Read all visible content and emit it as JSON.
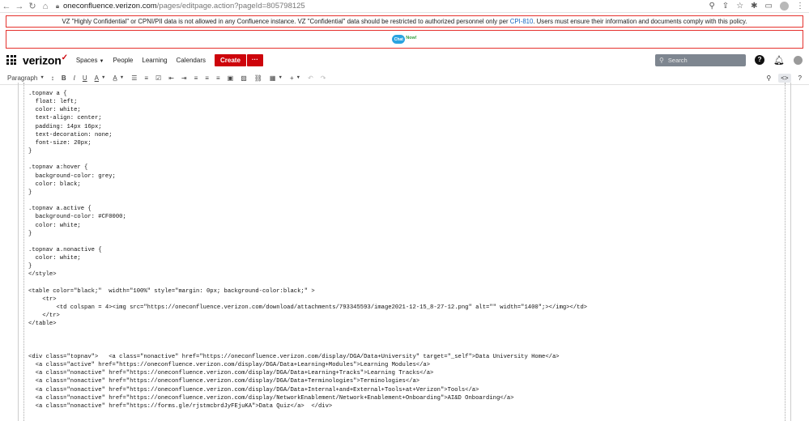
{
  "browser": {
    "url_host": "oneconfluence.verizon.com",
    "url_path": "/pages/editpage.action?pageId=805798125"
  },
  "banner": {
    "text_before": "VZ \"Highly Confidential\" or CPNI/PII data is not allowed in any Confluence instance. VZ \"Confidential\" data should be restricted to authorized personnel only per ",
    "link": "CPI-810",
    "text_after": ". Users must ensure their information and documents comply with this policy."
  },
  "chat": {
    "bubble": "Chat",
    "now": "Now!"
  },
  "header": {
    "logo": "verizon",
    "logo_mark": "✓",
    "nav": [
      "Spaces",
      "People",
      "Learning",
      "Calendars"
    ],
    "create_label": "Create",
    "more_label": "···",
    "search_placeholder": "Search",
    "help_label": "?"
  },
  "toolbar": {
    "paragraph_label": "Paragraph"
  },
  "editor": {
    "lines": [
      ".topnav a {",
      "  float: left;",
      "  color: white;",
      "  text-align: center;",
      "  padding: 14px 16px;",
      "  text-decoration: none;",
      "  font-size: 20px;",
      "}",
      "",
      ".topnav a:hover {",
      "  background-color: grey;",
      "  color: black;",
      "}",
      "",
      ".topnav a.active {",
      "  background-color: #CF0000;",
      "  color: white;",
      "}",
      "",
      ".topnav a.nonactive {",
      "  color: white;",
      "}",
      "</style>",
      "",
      "<table color=\"black;\"  width=\"100%\" style=\"margin: 0px; background-color:black;\" >",
      "    <tr>",
      "        <td colspan = 4><img src=\"https://oneconfluence.verizon.com/download/attachments/793345593/image2021-12-15_8-27-12.png\" alt=\"\" width=\"1400\";></img></td>",
      "    </tr>",
      "</table>",
      "",
      "",
      "",
      "<div class=\"topnav\">   <a class=\"nonactive\" href=\"https://oneconfluence.verizon.com/display/DGA/Data+University\" target=\"_self\">Data University Home</a>",
      "  <a class=\"active\" href=\"https://oneconfluence.verizon.com/display/DGA/Data+Learning+Modules\">Learning Modules</a>",
      "  <a class=\"nonactive\" href=\"https://oneconfluence.verizon.com/display/DGA/Data+Learning+Tracks\">Learning Tracks</a>",
      "  <a class=\"nonactive\" href=\"https://oneconfluence.verizon.com/display/DGA/Data+Terminologies\">Terminologies</a>",
      "  <a class=\"nonactive\" href=\"https://oneconfluence.verizon.com/display/DGA/Data+Internal+and+External+Tools+at+Verizon\">Tools</a>",
      "  <a class=\"nonactive\" href=\"https://oneconfluence.verizon.com/display/NetworkEnablement/Network+Enablement+Onboarding\">AI&D Onboarding</a>",
      "  <a class=\"nonactive\" href=\"https://forms.gle/rjstmcbrdJyFEjuKA\">Data Quiz</a>  </div>"
    ]
  },
  "icons": {
    "back": "back-arrow-icon",
    "forward": "forward-arrow-icon",
    "reload": "reload-icon",
    "home": "home-icon",
    "lock": "lock-icon",
    "zoom": "zoom-icon",
    "share": "share-icon",
    "bookmark": "bookmark-star-icon",
    "extensions": "puzzle-icon",
    "sidebar": "sidebar-icon",
    "profile": "profile-avatar-icon",
    "menu": "kebab-menu-icon",
    "app_grid": "app-grid-icon",
    "notifications": "bell-icon",
    "search": "search-icon",
    "find": "find-icon",
    "source": "source-code-icon"
  },
  "colors": {
    "brand_red": "#cd040b",
    "banner_border": "#e5322d",
    "search_bg": "#7e8690"
  }
}
